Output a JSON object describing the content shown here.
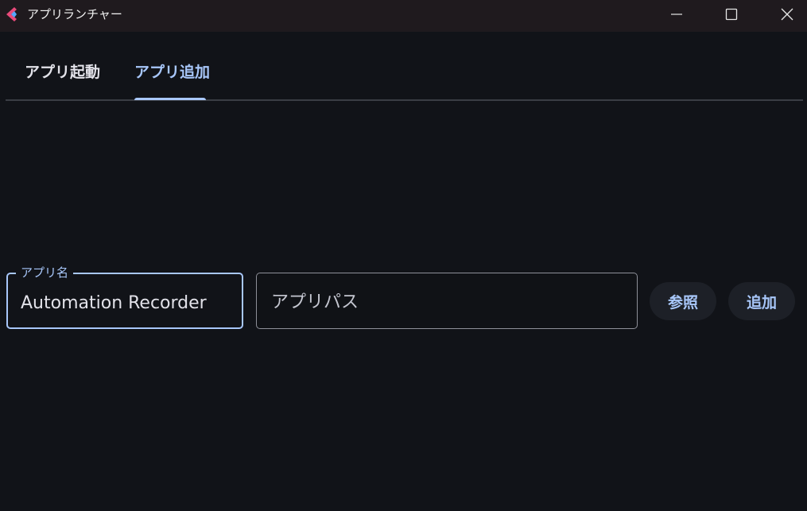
{
  "window": {
    "title": "アプリランチャー",
    "controls": [
      "minimize-icon",
      "maximize-icon",
      "close-icon"
    ]
  },
  "tabs": [
    {
      "label": "アプリ起動",
      "selected": false
    },
    {
      "label": "アプリ追加",
      "selected": true
    }
  ],
  "form": {
    "app_name": {
      "label": "アプリ名",
      "value": "Automation Recorder"
    },
    "app_path": {
      "placeholder": "アプリパス",
      "value": ""
    },
    "browse_label": "参照",
    "add_label": "追加"
  },
  "colors": {
    "background": "#111318",
    "titlebar": "#1f1a1e",
    "accent": "#a8c7fa",
    "button_bg": "#1d2027"
  }
}
